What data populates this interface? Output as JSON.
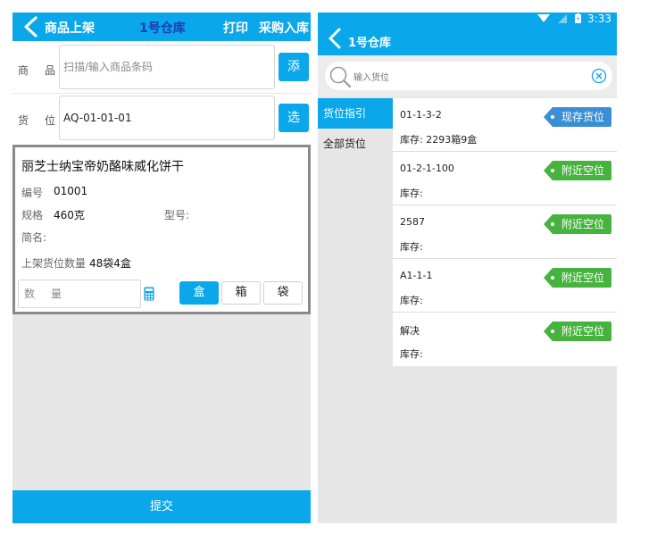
{
  "left_screen": {
    "header": {
      "title": "商品上架",
      "warehouse": "1号仓库",
      "print_label": "打印",
      "purchase_label": "采购入库"
    },
    "product_row": {
      "label_1": "商",
      "label_2": "品",
      "placeholder": "扫描/输入商品条码",
      "button_label": "添"
    },
    "location_row": {
      "label_1": "货",
      "label_2": "位",
      "value": "AQ-01-01-01",
      "button_label": "选"
    },
    "product_card": {
      "name": "丽芝士纳宝帝奶酪味威化饼干",
      "code_label": "编号",
      "code_value": "01001",
      "spec_label": "规格",
      "spec_value": "460克",
      "model_label": "型号:",
      "model_value": "",
      "short_name_label": "简名:",
      "short_name_value": "",
      "shelf_qty_label": "上架货位数量",
      "shelf_qty_value": "48袋4盒",
      "qty_placeholder_1": "数",
      "qty_placeholder_2": "量",
      "units": [
        "盒",
        "箱",
        "袋"
      ],
      "selected_unit": "盒"
    },
    "submit_label": "提交"
  },
  "right_screen": {
    "status_time": "3:33",
    "header": {
      "title": "1号仓库"
    },
    "search": {
      "placeholder": "输入货位"
    },
    "nav": [
      {
        "label": "货位指引",
        "active": true
      },
      {
        "label": "全部货位",
        "active": false
      }
    ],
    "locations": [
      {
        "code": "01-1-3-2",
        "stock": "库存: 2293箱9盒",
        "tag": "现存货位",
        "tag_type": "stock"
      },
      {
        "code": "01-2-1-100",
        "stock": "库存:",
        "tag": "附近空位",
        "tag_type": "near"
      },
      {
        "code": "2587",
        "stock": "库存:",
        "tag": "附近空位",
        "tag_type": "near"
      },
      {
        "code": "A1-1-1",
        "stock": "库存:",
        "tag": "附近空位",
        "tag_type": "near"
      },
      {
        "code": "解决",
        "stock": "库存:",
        "tag": "附近空位",
        "tag_type": "near"
      }
    ]
  },
  "colors": {
    "primary_blue": "#0aa7ea",
    "warehouse_text": "#1a3db5",
    "tag_stock": "#3a8fd4",
    "tag_near": "#47b33f"
  },
  "icons": [
    "chevron-left-icon",
    "calculator-icon",
    "search-icon",
    "clear-icon",
    "signal-icon",
    "battery-icon"
  ]
}
